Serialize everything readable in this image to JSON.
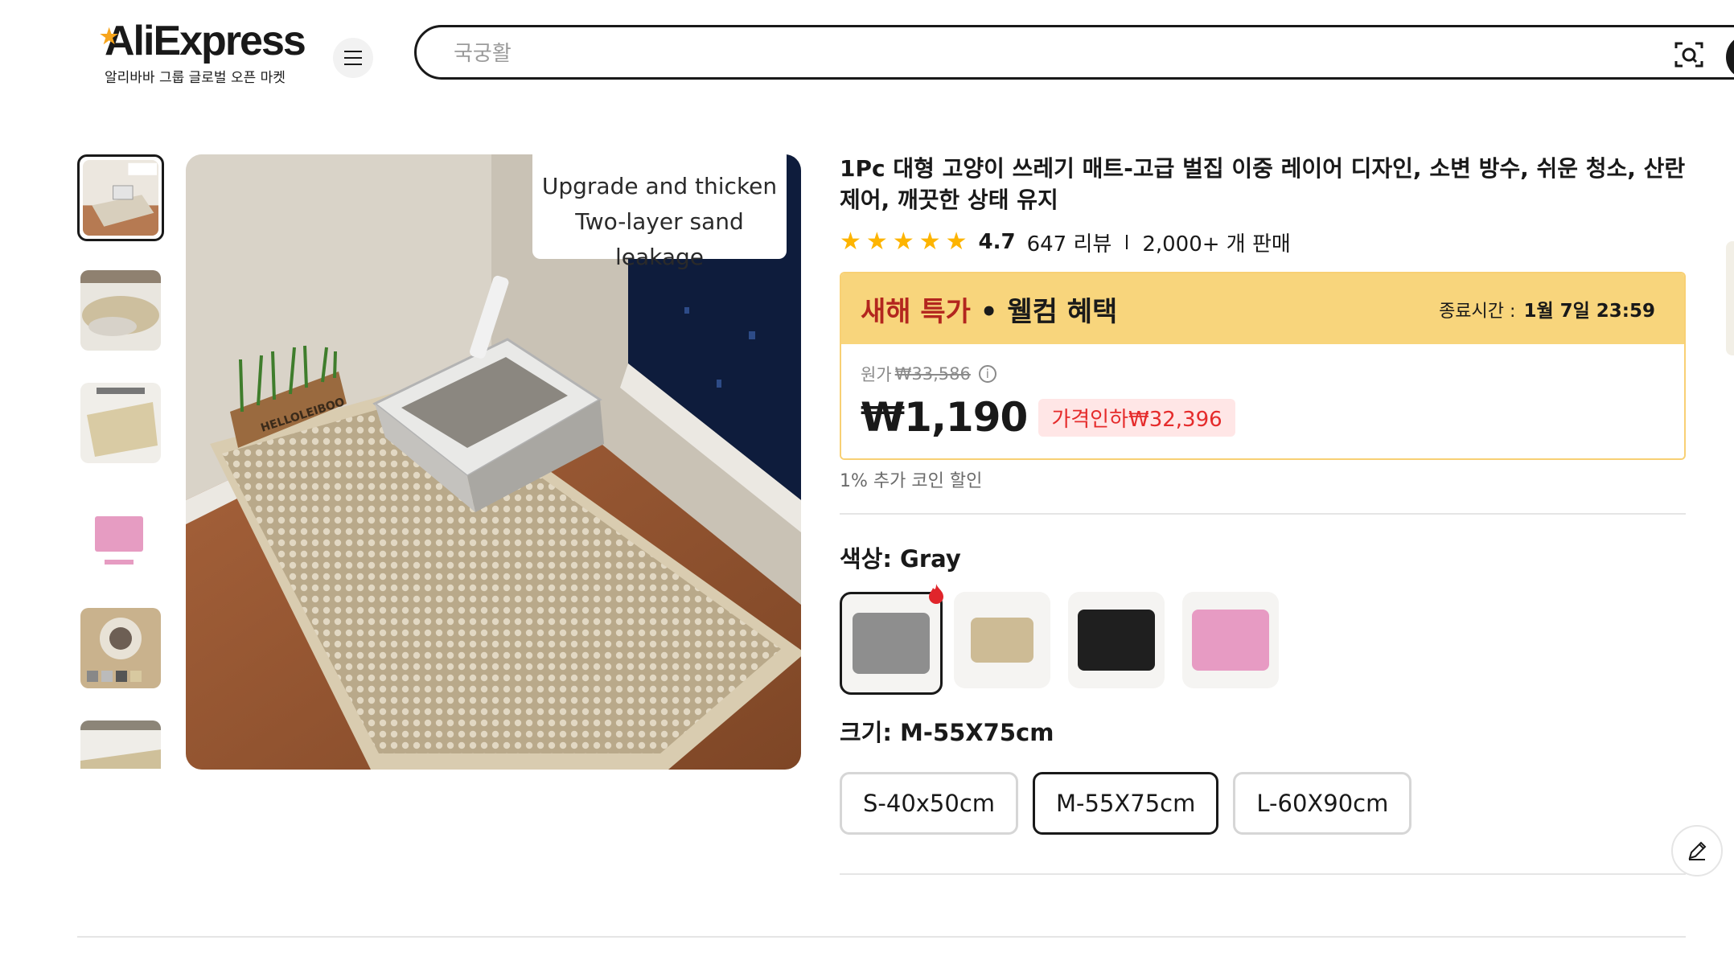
{
  "header": {
    "logo_text": "AliExpress",
    "logo_subtitle": "알리바바 그룹 글로벌 오픈 마켓",
    "menu_icon": "hamburger-menu-icon",
    "search_placeholder": "국궁활",
    "camera_icon": "camera-search-icon"
  },
  "gallery": {
    "caption_line1": "Upgrade and thicken",
    "caption_line2": "Two-layer sand leakage",
    "image_label": "HELLOLEIBOO",
    "thumbnails": [
      "thumb-1",
      "thumb-2",
      "thumb-3",
      "thumb-4",
      "thumb-5",
      "thumb-6"
    ],
    "active_index": 0
  },
  "product": {
    "title": "1Pc 대형 고양이 쓰레기 매트-고급 벌집 이중 레이어 디자인, 소변 방수, 쉬운 청소, 산란 제어, 깨끗한 상태 유지",
    "rating": "4.7",
    "reviews": "647 리뷰",
    "sold": "2,000+ 개 판매",
    "star_count": 5
  },
  "promo": {
    "title_red": "새해 특가",
    "title_rest": " • 웰컴 혜택",
    "end_label": "종료시간 :",
    "end_time": "1월 7일 23:59",
    "original_label": "원가",
    "original_price": "₩33,586",
    "price": "₩1,190",
    "discount": "가격인하₩32,396",
    "coin_note": "1% 추가 코인 할인"
  },
  "color_option": {
    "label": "색상: Gray",
    "swatches": [
      {
        "name": "Gray",
        "color": "#8e8e8e"
      },
      {
        "name": "Beige",
        "color": "#cdbb95"
      },
      {
        "name": "Black",
        "color": "#1f1f1f"
      },
      {
        "name": "Pink",
        "color": "#e79bc3"
      }
    ],
    "selected": "Gray"
  },
  "size_option": {
    "label": "크기: M-55X75cm",
    "sizes": [
      "S-40x50cm",
      "M-55X75cm",
      "L-60X90cm"
    ],
    "selected": "M-55X75cm"
  },
  "colors": {
    "promo_bg": "#f8d57c",
    "promo_red": "#b3261e",
    "discount_text": "#e52b2b",
    "star": "#fdb400"
  }
}
